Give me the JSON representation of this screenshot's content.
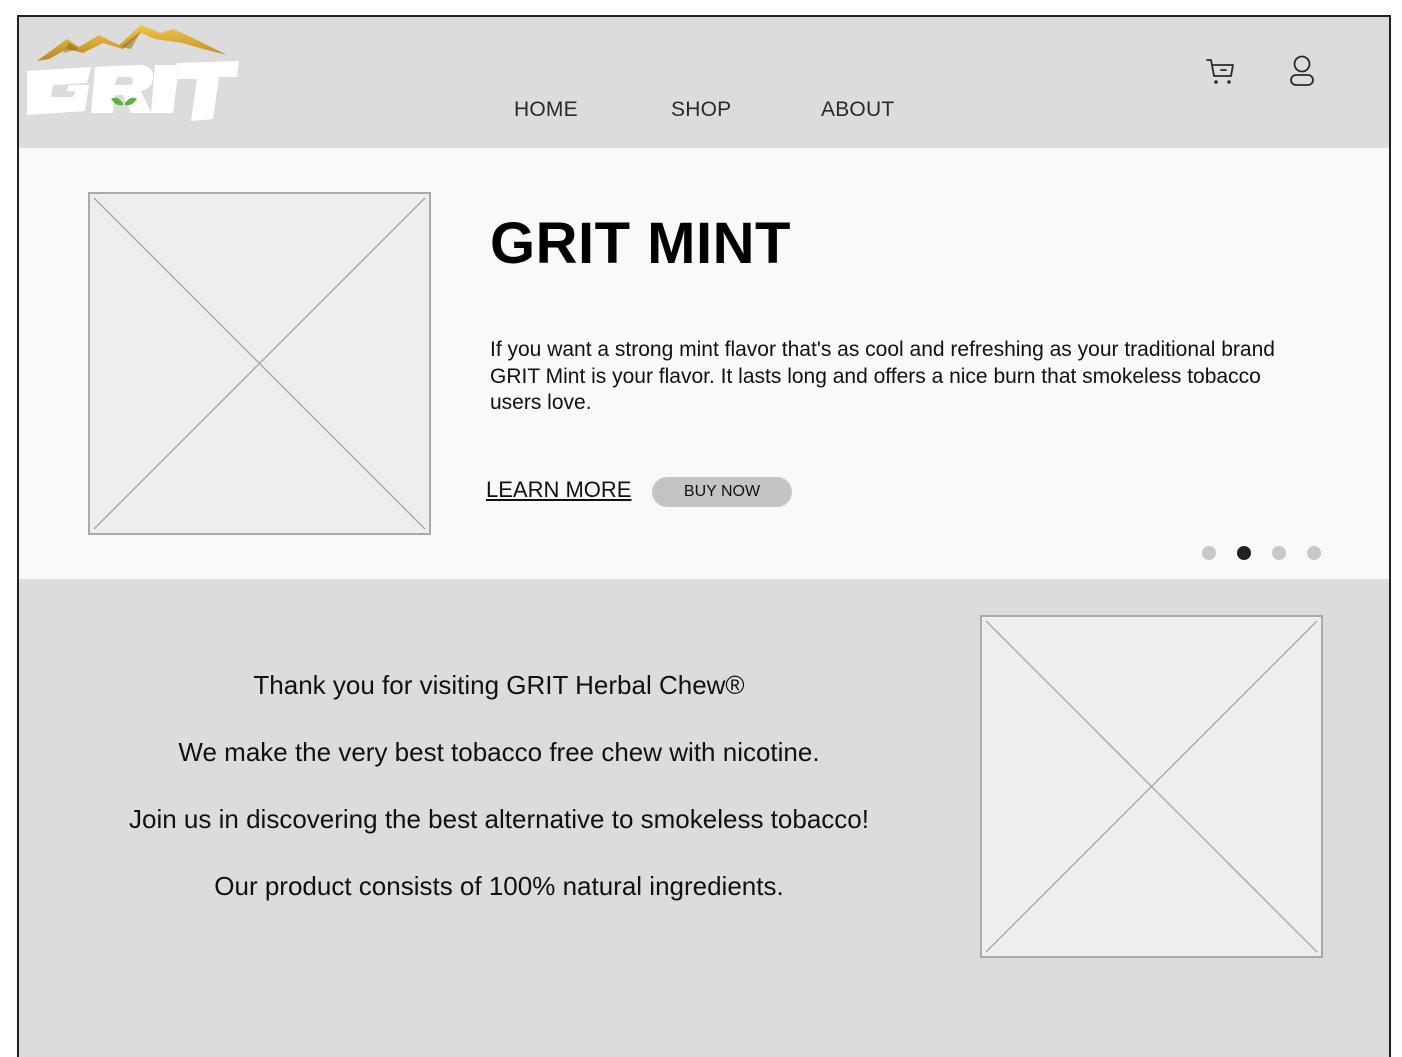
{
  "brand": {
    "logo_text": "GRIT",
    "logo_colors": {
      "mountain": "#d8a52c",
      "letters": "#ffffff",
      "leaf": "#5bb33f"
    }
  },
  "header": {
    "nav": [
      {
        "label": "HOME"
      },
      {
        "label": "SHOP"
      },
      {
        "label": "ABOUT"
      }
    ],
    "icons": [
      "cart-icon",
      "user-icon"
    ]
  },
  "hero": {
    "image_icon": "image-placeholder",
    "title": "GRIT MINT",
    "description": "If you want a strong mint flavor that's as cool and refreshing as your traditional brand GRIT Mint is your flavor. It lasts long and offers a nice burn that smokeless tobacco users love.",
    "learn_more_label": "LEARN MORE",
    "buy_now_label": "BUY NOW",
    "carousel": {
      "slide_count": 4,
      "active_index": 1
    }
  },
  "about": {
    "lines": [
      "Thank you for visiting GRIT Herbal Chew®",
      "We make the very best tobacco free chew with nicotine.",
      "Join us in discovering the best alternative to smokeless tobacco!",
      "Our product consists of 100% natural ingredients."
    ],
    "image_icon": "image-placeholder"
  },
  "colors": {
    "header_bg": "#dcdcdc",
    "hero_bg": "#f9f9f9",
    "about_bg": "#dcdcdc",
    "button_bg": "#c4c4c4",
    "dot_active": "#222222",
    "dot_inactive": "#c8c8c8"
  }
}
